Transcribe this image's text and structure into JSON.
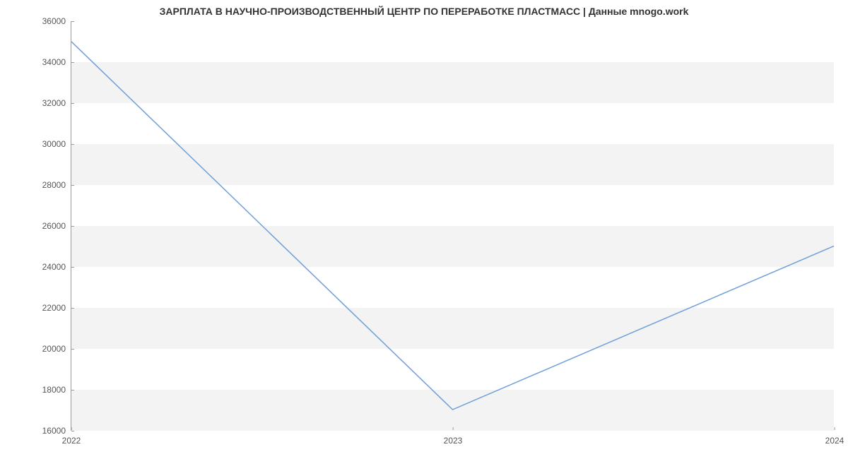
{
  "chart_data": {
    "type": "line",
    "title": "ЗАРПЛАТА В НАУЧНО-ПРОИЗВОДСТВЕННЫЙ ЦЕНТР ПО ПЕРЕРАБОТКЕ ПЛАСТМАСС | Данные mnogo.work",
    "xlabel": "",
    "ylabel": "",
    "x": [
      2022,
      2023,
      2024
    ],
    "values": [
      35000,
      17000,
      25000
    ],
    "xlim": [
      2022,
      2024
    ],
    "ylim": [
      16000,
      36000
    ],
    "y_ticks": [
      16000,
      18000,
      20000,
      22000,
      24000,
      26000,
      28000,
      30000,
      32000,
      34000,
      36000
    ],
    "x_ticks": [
      2022,
      2023,
      2024
    ],
    "line_color": "#6f9fd8"
  }
}
